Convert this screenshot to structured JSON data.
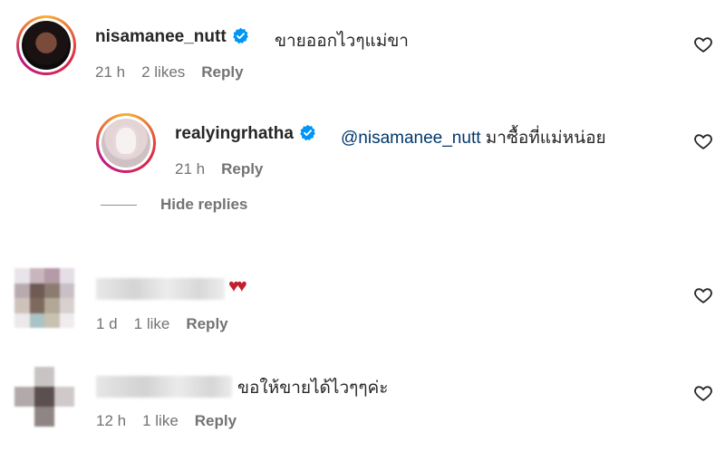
{
  "comments": [
    {
      "username": "nisamanee_nutt",
      "text": "ขายออกไวๆแม่ขา",
      "time": "21 h",
      "likes": "2 likes",
      "reply_label": "Reply"
    },
    {
      "username": "realyingrhatha",
      "mention": "@nisamanee_nutt",
      "text": "มาซื้อที่แม่หน่อย",
      "time": "21 h",
      "reply_label": "Reply"
    },
    {
      "username": "",
      "text": "♥♥",
      "time": "1 d",
      "likes": "1 like",
      "reply_label": "Reply"
    },
    {
      "username": "",
      "text": "ขอให้ขายได้ไวๆๆค่ะ",
      "time": "12 h",
      "likes": "1 like",
      "reply_label": "Reply"
    }
  ],
  "hide_replies_label": "Hide replies",
  "colors": {
    "heart_red": "#c21f2f",
    "mention": "#00376b",
    "verified_blue": "#0095f6"
  },
  "icons": {
    "like": "heart-outline-icon",
    "verified": "verified-badge-icon"
  }
}
